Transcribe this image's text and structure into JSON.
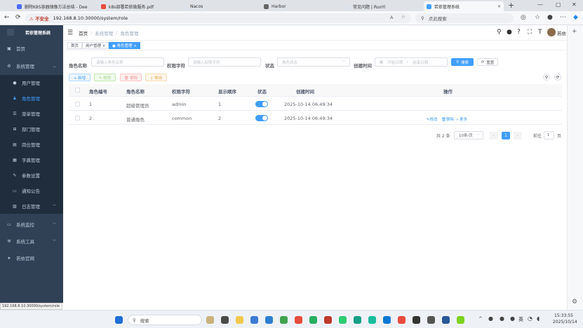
{
  "browser": {
    "tabs": [
      {
        "title": "删除K8S容器镜像方法总结 - Dee",
        "color": "#4b6bfb"
      },
      {
        "title": "k8s部署若依微服务.pdf",
        "color": "#e74c3c"
      },
      {
        "title": "Nacos",
        "color": "#e7e7e7"
      },
      {
        "title": "Harbor",
        "color": "#666666"
      },
      {
        "title": "常见问题 | RuoYi",
        "color": "#e7e7e7"
      },
      {
        "title": "若依管理系统",
        "color": "#409eff"
      }
    ],
    "insecure_label": "不安全",
    "url": "192.168.8.10:30000/system/role",
    "search_placeholder": "点此搜索"
  },
  "sidebar": {
    "title": "若依管理系统",
    "items": [
      {
        "label": "首页",
        "icon": "dashboard-icon"
      },
      {
        "label": "系统管理",
        "icon": "gear-icon"
      },
      {
        "label": "用户管理",
        "icon": "user-icon"
      },
      {
        "label": "角色管理",
        "icon": "peoples-icon"
      },
      {
        "label": "菜单管理",
        "icon": "tree-icon"
      },
      {
        "label": "部门管理",
        "icon": "tree-table-icon"
      },
      {
        "label": "岗位管理",
        "icon": "post-icon"
      },
      {
        "label": "字典管理",
        "icon": "dict-icon"
      },
      {
        "label": "参数设置",
        "icon": "edit-icon"
      },
      {
        "label": "通知公告",
        "icon": "message-icon"
      },
      {
        "label": "日志管理",
        "icon": "log-icon"
      },
      {
        "label": "系统监控",
        "icon": "monitor-icon"
      },
      {
        "label": "系统工具",
        "icon": "tool-icon"
      },
      {
        "label": "若依官网",
        "icon": "guide-icon"
      }
    ]
  },
  "navbar": {
    "breadcrumb": [
      "首页",
      "系统管理",
      "角色管理"
    ],
    "username": "若依"
  },
  "tags": [
    {
      "label": "首页"
    },
    {
      "label": "用户管理 ×"
    },
    {
      "label": "● 角色管理 ×"
    }
  ],
  "filters": {
    "role_name_label": "角色名称",
    "role_name_placeholder": "请输入角色名称",
    "role_key_label": "权限字符",
    "role_key_placeholder": "请输入权限字符",
    "status_label": "状态",
    "status_placeholder": "角色状态",
    "created_label": "创建时间",
    "start_placeholder": "开始日期",
    "dash": "-",
    "end_placeholder": "结束日期",
    "search_btn": "搜索",
    "reset_btn": "重置"
  },
  "toolbar": {
    "add": "+ 新增",
    "edit": "✎ 修改",
    "delete": "🗑 删除",
    "export": "↓ 导出"
  },
  "table": {
    "headers": [
      "角色编号",
      "角色名称",
      "权限字符",
      "显示顺序",
      "状态",
      "创建时间",
      "操作"
    ],
    "rows": [
      {
        "id": "1",
        "name": "超级管理员",
        "key": "admin",
        "sort": "1",
        "status": true,
        "created": "2025-10-14 06:49:34",
        "ops": []
      },
      {
        "id": "2",
        "name": "普通角色",
        "key": "common",
        "sort": "2",
        "status": true,
        "created": "2025-10-14 06:49:34",
        "ops": [
          "✎修改",
          "🗑删除",
          "» 更多"
        ]
      }
    ]
  },
  "pagination": {
    "total": "共 2 条",
    "page_size": "10条/页",
    "current_page": "1",
    "goto_label": "前往",
    "goto_value": "1",
    "page_unit": "页"
  },
  "statusbar": {
    "url": "192.168.8.10:30000/system/role"
  },
  "taskbar": {
    "search": "搜索",
    "weather_temp": "",
    "lang": "英",
    "time": "15:33:55",
    "date": "2025/10/14"
  }
}
